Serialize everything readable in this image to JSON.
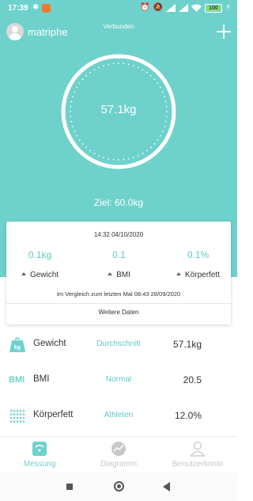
{
  "status_bar": {
    "time": "17:39",
    "bluetooth_icon": "bluetooth-icon",
    "app_icon": "orange-app-icon",
    "right_icons": [
      "alarm-icon",
      "mute-icon",
      "signal-icon",
      "signal-icon",
      "wifi-icon"
    ],
    "battery_level": "100",
    "charging_icon": "bolt-icon"
  },
  "header": {
    "username": "matriphe",
    "connection_status": "Verbunden",
    "add_icon": "plus-icon"
  },
  "gauge": {
    "weight": "57.1kg",
    "goal": "Ziel: 60.0kg"
  },
  "comparison": {
    "datetime": "14:32 04/10/2020",
    "items": [
      {
        "delta": "0.1kg",
        "label": "Gewicht"
      },
      {
        "delta": "0.1",
        "label": "BMI"
      },
      {
        "delta": "0.1%",
        "label": "Körperfett"
      }
    ],
    "note": "Im Vergleich zum letzten Mal 08:43 28/09/2020",
    "more_label": "Weitere Daten"
  },
  "metrics": [
    {
      "icon": "scale-kg-icon",
      "label": "Gewicht",
      "status": "Durchschnitt",
      "value": "57.1kg"
    },
    {
      "icon": "bmi-icon",
      "icon_text": "BMI",
      "label": "BMI",
      "status": "Normal",
      "value": "20.5"
    },
    {
      "icon": "body-fat-dots-icon",
      "label": "Körperfett",
      "status": "Athleten",
      "value": "12.0%"
    }
  ],
  "bottom_nav": [
    {
      "icon": "scale-icon",
      "label": "Messung",
      "active": true
    },
    {
      "icon": "chart-icon",
      "label": "Diagramm",
      "active": false
    },
    {
      "icon": "user-icon",
      "label": "Benutzerkonto",
      "active": false
    }
  ],
  "colors": {
    "accent": "#6ed1cc",
    "accent_text": "#5ec8c4",
    "inactive": "#c8c8c8"
  }
}
